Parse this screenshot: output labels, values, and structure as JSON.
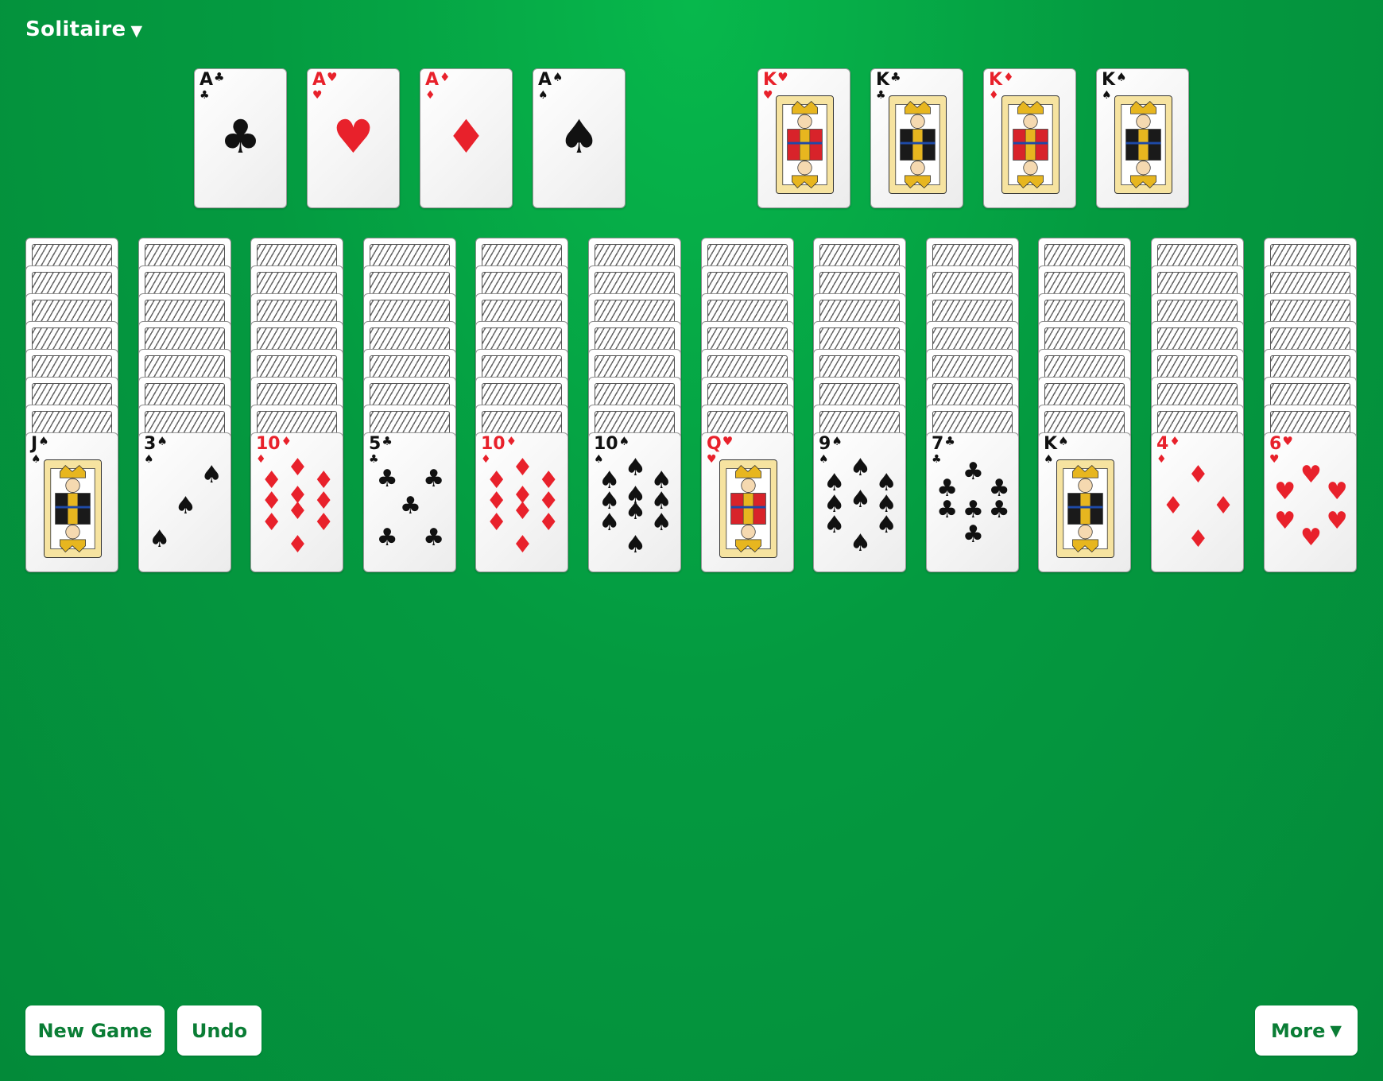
{
  "header": {
    "title": "Solitaire",
    "caret": "▼"
  },
  "foundations": [
    {
      "rank": "A",
      "suit": "♣",
      "color": "black"
    },
    {
      "rank": "A",
      "suit": "♥",
      "color": "red"
    },
    {
      "rank": "A",
      "suit": "♦",
      "color": "red"
    },
    {
      "rank": "A",
      "suit": "♠",
      "color": "black"
    }
  ],
  "completed_kings": [
    {
      "rank": "K",
      "suit": "♥",
      "color": "red"
    },
    {
      "rank": "K",
      "suit": "♣",
      "color": "black"
    },
    {
      "rank": "K",
      "suit": "♦",
      "color": "red"
    },
    {
      "rank": "K",
      "suit": "♠",
      "color": "black"
    }
  ],
  "tableau": [
    {
      "facedown": 7,
      "rank": "J",
      "suit": "♠",
      "color": "black"
    },
    {
      "facedown": 7,
      "rank": "3",
      "suit": "♠",
      "color": "black"
    },
    {
      "facedown": 7,
      "rank": "10",
      "suit": "♦",
      "color": "red"
    },
    {
      "facedown": 7,
      "rank": "5",
      "suit": "♣",
      "color": "black"
    },
    {
      "facedown": 7,
      "rank": "10",
      "suit": "♦",
      "color": "red"
    },
    {
      "facedown": 7,
      "rank": "10",
      "suit": "♠",
      "color": "black"
    },
    {
      "facedown": 7,
      "rank": "Q",
      "suit": "♥",
      "color": "red"
    },
    {
      "facedown": 7,
      "rank": "9",
      "suit": "♠",
      "color": "black"
    },
    {
      "facedown": 7,
      "rank": "7",
      "suit": "♣",
      "color": "black"
    },
    {
      "facedown": 7,
      "rank": "K",
      "suit": "♠",
      "color": "black"
    },
    {
      "facedown": 7,
      "rank": "4",
      "suit": "♦",
      "color": "red"
    },
    {
      "facedown": 7,
      "rank": "6",
      "suit": "♥",
      "color": "red"
    }
  ],
  "buttons": {
    "new_game": "New Game",
    "undo": "Undo",
    "more": "More",
    "more_caret": "▼"
  },
  "colors": {
    "felt": "#049a40",
    "red_suit": "#e8212b",
    "button_text": "#0a7d35"
  }
}
